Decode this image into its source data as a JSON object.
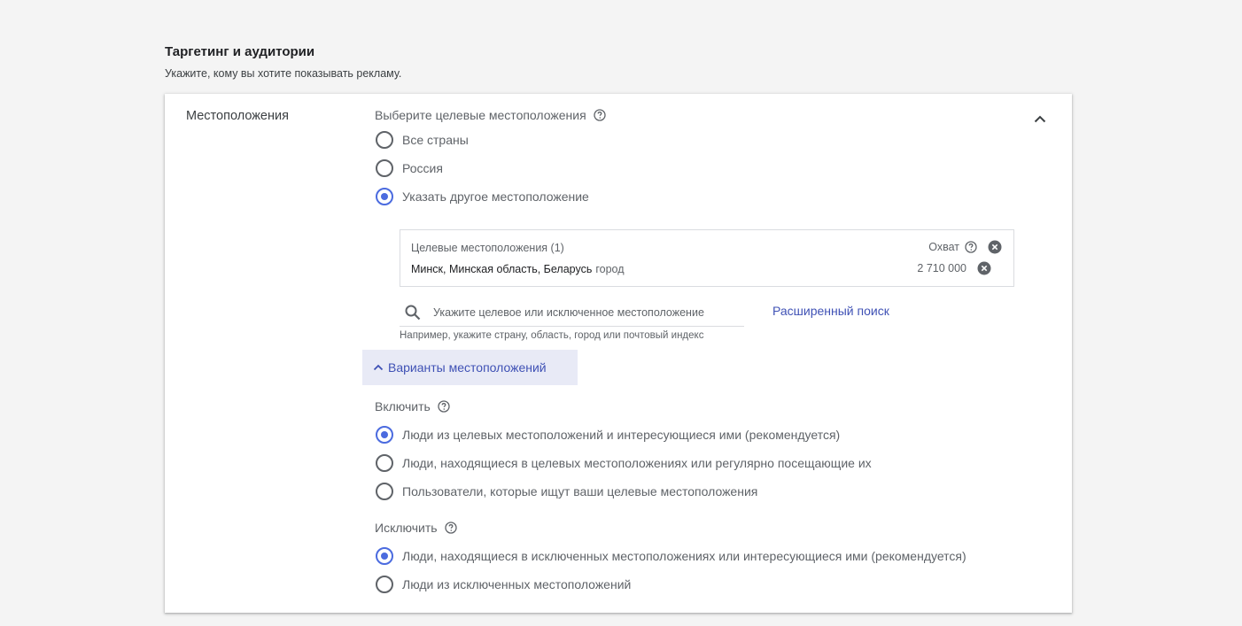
{
  "section": {
    "title": "Таргетинг и аудитории",
    "subtitle": "Укажите, кому вы хотите показывать рекламу."
  },
  "locations": {
    "label": "Местоположения",
    "select_label": "Выберите целевые местоположения",
    "options": [
      {
        "label": "Все страны",
        "checked": false
      },
      {
        "label": "Россия",
        "checked": false
      },
      {
        "label": "Указать другое местоположение",
        "checked": true
      }
    ],
    "targets": {
      "header": "Целевые местоположения (1)",
      "reach_header": "Охват",
      "items": [
        {
          "name": "Минск, Минская область, Беларусь",
          "type": "город",
          "reach": "2 710 000"
        }
      ]
    },
    "search": {
      "placeholder": "Укажите целевое или исключенное местоположение",
      "hint": "Например, укажите страну, область, город или почтовый индекс",
      "advanced_label": "Расширенный поиск"
    },
    "options_toggle_label": "Варианты местоположений",
    "include": {
      "label": "Включить",
      "options": [
        {
          "label": "Люди из целевых местоположений и интересующиеся ими (рекомендуется)",
          "checked": true
        },
        {
          "label": "Люди, находящиеся в целевых местоположениях или регулярно посещающие их",
          "checked": false
        },
        {
          "label": "Пользователи, которые ищут ваши целевые местоположения",
          "checked": false
        }
      ]
    },
    "exclude": {
      "label": "Исключить",
      "options": [
        {
          "label": "Люди, находящиеся в исключенных местоположениях или интересующиеся ими (рекомендуется)",
          "checked": true
        },
        {
          "label": "Люди из исключенных местоположений",
          "checked": false
        }
      ]
    }
  },
  "colors": {
    "accent": "#4b6bdf",
    "link": "#3f51b5",
    "toggle_bg": "#e8eaf6",
    "background": "#f4f4f4"
  }
}
